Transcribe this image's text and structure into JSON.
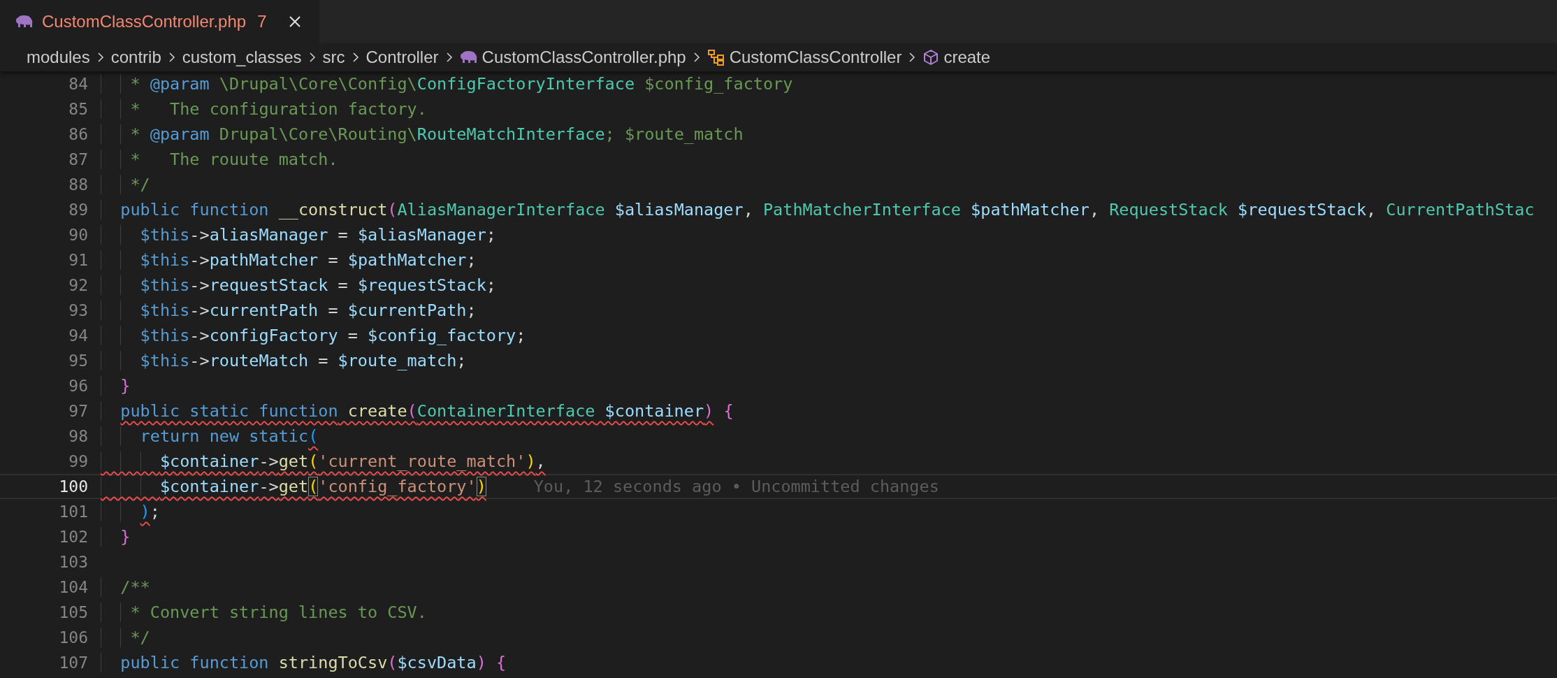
{
  "tab": {
    "label": "CustomClassController.php",
    "problems": "7",
    "selected": true,
    "modified_errors": true
  },
  "breadcrumbs": [
    {
      "label": "modules",
      "kind": "folder"
    },
    {
      "label": "contrib",
      "kind": "folder"
    },
    {
      "label": "custom_classes",
      "kind": "folder"
    },
    {
      "label": "src",
      "kind": "folder"
    },
    {
      "label": "Controller",
      "kind": "folder"
    },
    {
      "label": "CustomClassController.php",
      "kind": "file"
    },
    {
      "label": "CustomClassController",
      "kind": "class"
    },
    {
      "label": "create",
      "kind": "method"
    }
  ],
  "lines": [
    {
      "number": "84",
      "current": false,
      "tokens": [
        {
          "text": "   * ",
          "kind": "cm"
        },
        {
          "text": "@param",
          "kind": "tag"
        },
        {
          "text": " \\Drupal\\Core\\Config\\",
          "kind": "cm"
        },
        {
          "text": "ConfigFactoryInterface",
          "kind": "cmtype"
        },
        {
          "text": " $config_factory",
          "kind": "cm"
        }
      ]
    },
    {
      "number": "85",
      "current": false,
      "tokens": [
        {
          "text": "   *   The configuration factory.",
          "kind": "cm"
        }
      ]
    },
    {
      "number": "86",
      "current": false,
      "tokens": [
        {
          "text": "   * ",
          "kind": "cm"
        },
        {
          "text": "@param",
          "kind": "tag"
        },
        {
          "text": " Drupal\\Core\\Routing\\",
          "kind": "cm"
        },
        {
          "text": "RouteMatchInterface",
          "kind": "cmtype"
        },
        {
          "text": "; $route_match",
          "kind": "cm"
        }
      ]
    },
    {
      "number": "87",
      "current": false,
      "tokens": [
        {
          "text": "   *   The rouute match.",
          "kind": "cm"
        }
      ]
    },
    {
      "number": "88",
      "current": false,
      "tokens": [
        {
          "text": "   */",
          "kind": "cm"
        }
      ]
    },
    {
      "number": "89",
      "current": false,
      "tokens": [
        {
          "text": "  public function",
          "kind": "kw"
        },
        {
          "text": " __construct",
          "kind": "fn"
        },
        {
          "text": "(",
          "kind": "b2"
        },
        {
          "text": "AliasManagerInterface",
          "kind": "type"
        },
        {
          "text": " $aliasManager",
          "kind": "var"
        },
        {
          "text": ", ",
          "kind": "op"
        },
        {
          "text": "PathMatcherInterface",
          "kind": "type"
        },
        {
          "text": " $pathMatcher",
          "kind": "var"
        },
        {
          "text": ", ",
          "kind": "op"
        },
        {
          "text": "RequestStack",
          "kind": "type"
        },
        {
          "text": " $requestStack",
          "kind": "var"
        },
        {
          "text": ", ",
          "kind": "op"
        },
        {
          "text": "CurrentPathStac",
          "kind": "type"
        }
      ]
    },
    {
      "number": "90",
      "current": false,
      "tokens": [
        {
          "text": "    $this",
          "kind": "this"
        },
        {
          "text": "->",
          "kind": "op"
        },
        {
          "text": "aliasManager",
          "kind": "var"
        },
        {
          "text": " = ",
          "kind": "op"
        },
        {
          "text": "$aliasManager",
          "kind": "var"
        },
        {
          "text": ";",
          "kind": "op"
        }
      ]
    },
    {
      "number": "91",
      "current": false,
      "tokens": [
        {
          "text": "    $this",
          "kind": "this"
        },
        {
          "text": "->",
          "kind": "op"
        },
        {
          "text": "pathMatcher",
          "kind": "var"
        },
        {
          "text": " = ",
          "kind": "op"
        },
        {
          "text": "$pathMatcher",
          "kind": "var"
        },
        {
          "text": ";",
          "kind": "op"
        }
      ]
    },
    {
      "number": "92",
      "current": false,
      "tokens": [
        {
          "text": "    $this",
          "kind": "this"
        },
        {
          "text": "->",
          "kind": "op"
        },
        {
          "text": "requestStack",
          "kind": "var"
        },
        {
          "text": " = ",
          "kind": "op"
        },
        {
          "text": "$requestStack",
          "kind": "var"
        },
        {
          "text": ";",
          "kind": "op"
        }
      ]
    },
    {
      "number": "93",
      "current": false,
      "tokens": [
        {
          "text": "    $this",
          "kind": "this"
        },
        {
          "text": "->",
          "kind": "op"
        },
        {
          "text": "currentPath",
          "kind": "var"
        },
        {
          "text": " = ",
          "kind": "op"
        },
        {
          "text": "$currentPath",
          "kind": "var"
        },
        {
          "text": ";",
          "kind": "op"
        }
      ]
    },
    {
      "number": "94",
      "current": false,
      "tokens": [
        {
          "text": "    $this",
          "kind": "this"
        },
        {
          "text": "->",
          "kind": "op"
        },
        {
          "text": "configFactory",
          "kind": "var"
        },
        {
          "text": " = ",
          "kind": "op"
        },
        {
          "text": "$config_factory",
          "kind": "var"
        },
        {
          "text": ";",
          "kind": "op"
        }
      ]
    },
    {
      "number": "95",
      "current": false,
      "tokens": [
        {
          "text": "    $this",
          "kind": "this"
        },
        {
          "text": "->",
          "kind": "op"
        },
        {
          "text": "routeMatch",
          "kind": "var"
        },
        {
          "text": " = ",
          "kind": "op"
        },
        {
          "text": "$route_match",
          "kind": "var"
        },
        {
          "text": ";",
          "kind": "op"
        }
      ]
    },
    {
      "number": "96",
      "current": false,
      "tokens": [
        {
          "text": "  }",
          "kind": "b2"
        }
      ]
    },
    {
      "number": "97",
      "current": false,
      "tokens": [
        {
          "text": "  public static function",
          "kind": "kw",
          "error": true
        },
        {
          "text": " create",
          "kind": "fn",
          "error": true
        },
        {
          "text": "(",
          "kind": "b2",
          "error": true
        },
        {
          "text": "ContainerInterface",
          "kind": "type",
          "error": true
        },
        {
          "text": " $container",
          "kind": "var",
          "error": true
        },
        {
          "text": ")",
          "kind": "b2",
          "error": true
        },
        {
          "text": " {",
          "kind": "b2"
        }
      ]
    },
    {
      "number": "98",
      "current": false,
      "tokens": [
        {
          "text": "    return new static",
          "kind": "kw"
        },
        {
          "text": "(",
          "kind": "b3",
          "error": true
        }
      ]
    },
    {
      "number": "99",
      "current": false,
      "tokens": [
        {
          "text": "      $container",
          "kind": "var",
          "error": true
        },
        {
          "text": "->",
          "kind": "op",
          "error": true
        },
        {
          "text": "get",
          "kind": "fn",
          "error": true
        },
        {
          "text": "(",
          "kind": "b1",
          "error": true
        },
        {
          "text": "'current_route_match'",
          "kind": "str",
          "error": true
        },
        {
          "text": ")",
          "kind": "b1",
          "error": true
        },
        {
          "text": ",",
          "kind": "op",
          "error": true
        }
      ]
    },
    {
      "number": "100",
      "current": true,
      "annotation": "You, 12 seconds ago • Uncommitted changes",
      "tokens": [
        {
          "text": "      $container",
          "kind": "var",
          "error": true
        },
        {
          "text": "->",
          "kind": "op",
          "error": true
        },
        {
          "text": "get",
          "kind": "fn",
          "error": true
        },
        {
          "text": "(",
          "kind": "b1",
          "error": true,
          "matched": true
        },
        {
          "text": "'config_factory'",
          "kind": "str",
          "error": true
        },
        {
          "text": ")",
          "kind": "b1",
          "error": true,
          "matched": true
        }
      ]
    },
    {
      "number": "101",
      "current": false,
      "tokens": [
        {
          "text": "    )",
          "kind": "b3",
          "error": true
        },
        {
          "text": ";",
          "kind": "op"
        }
      ]
    },
    {
      "number": "102",
      "current": false,
      "tokens": [
        {
          "text": "  }",
          "kind": "b2"
        }
      ]
    },
    {
      "number": "103",
      "current": false
    },
    {
      "number": "104",
      "current": false,
      "tokens": [
        {
          "text": "  /**",
          "kind": "cm"
        }
      ]
    },
    {
      "number": "105",
      "current": false,
      "tokens": [
        {
          "text": "   * Convert string lines to CSV.",
          "kind": "cm"
        }
      ]
    },
    {
      "number": "106",
      "current": false,
      "tokens": [
        {
          "text": "   */",
          "kind": "cm"
        }
      ]
    },
    {
      "number": "107",
      "current": false,
      "tokens": [
        {
          "text": "  public function",
          "kind": "kw"
        },
        {
          "text": " stringToCsv",
          "kind": "fn"
        },
        {
          "text": "(",
          "kind": "b2"
        },
        {
          "text": "$csvData",
          "kind": "var"
        },
        {
          "text": ")",
          "kind": "b2"
        },
        {
          "text": " {",
          "kind": "b2"
        }
      ]
    }
  ]
}
